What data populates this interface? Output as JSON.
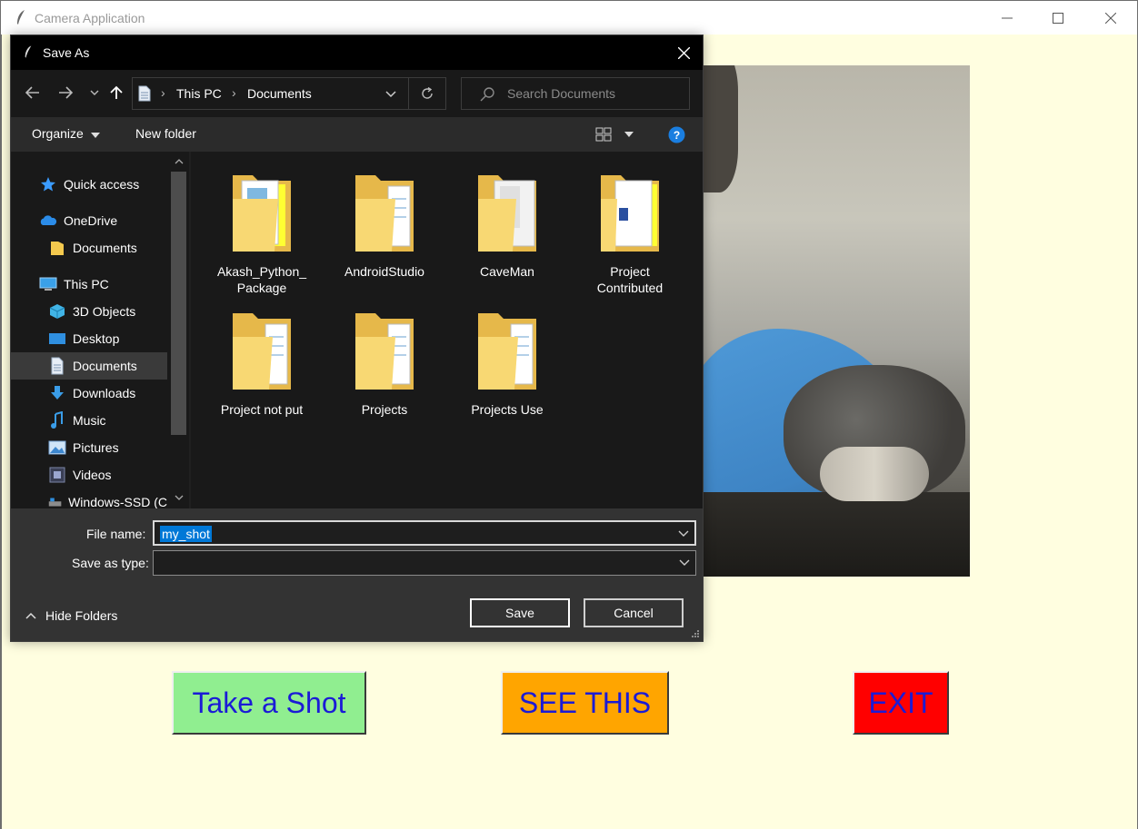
{
  "app": {
    "title": "Camera Application"
  },
  "dialog": {
    "title": "Save As",
    "breadcrumb": [
      "This PC",
      "Documents"
    ],
    "search_placeholder": "Search Documents",
    "toolbar": {
      "organize": "Organize",
      "new_folder": "New folder"
    },
    "nav_items": [
      {
        "label": "Quick access",
        "icon": "star-icon"
      },
      {
        "label": "OneDrive",
        "icon": "cloud-icon"
      },
      {
        "label": "Documents",
        "icon": "folder-icon"
      },
      {
        "label": "This PC",
        "icon": "computer-icon"
      },
      {
        "label": "3D Objects",
        "icon": "cube-icon"
      },
      {
        "label": "Desktop",
        "icon": "desktop-icon"
      },
      {
        "label": "Documents",
        "icon": "document-icon",
        "selected": true
      },
      {
        "label": "Downloads",
        "icon": "download-icon"
      },
      {
        "label": "Music",
        "icon": "music-icon"
      },
      {
        "label": "Pictures",
        "icon": "pictures-icon"
      },
      {
        "label": "Videos",
        "icon": "videos-icon"
      },
      {
        "label": "Windows-SSD (C",
        "icon": "drive-icon"
      }
    ],
    "folders": [
      {
        "line1": "Akash_Python_",
        "line2": "Package"
      },
      {
        "line1": "AndroidStudio",
        "line2": ""
      },
      {
        "line1": "CaveMan",
        "line2": ""
      },
      {
        "line1": "Project",
        "line2": "Contributed"
      },
      {
        "line1": "Project not put",
        "line2": ""
      },
      {
        "line1": "Projects",
        "line2": ""
      },
      {
        "line1": "Projects Use",
        "line2": ""
      }
    ],
    "file_name_label": "File name:",
    "file_name_value": "my_shot",
    "save_type_label": "Save as type:",
    "save_type_value": "",
    "hide_folders": "Hide Folders",
    "save": "Save",
    "cancel": "Cancel"
  },
  "buttons": {
    "take_shot": "Take a Shot",
    "see_this": "SEE THIS",
    "exit": "EXIT"
  },
  "colors": {
    "background": "#fffee0",
    "take_shot": "#90ee90",
    "see_this": "#ffa500",
    "exit": "#ff0000",
    "button_text": "#1b1bd6"
  }
}
